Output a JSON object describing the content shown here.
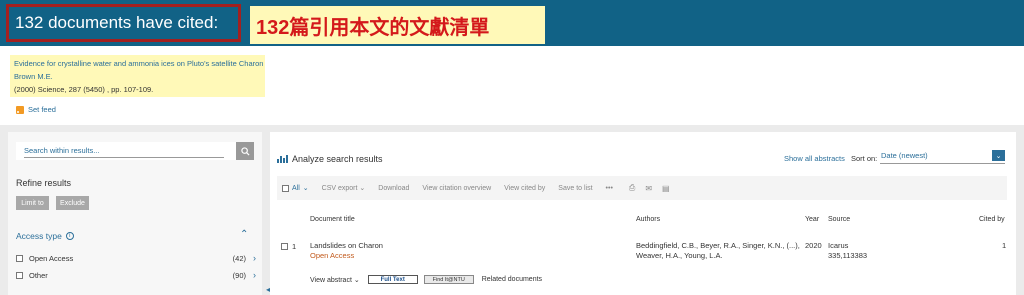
{
  "header": {
    "cited_count_text": "132 documents have cited:",
    "zh_annotation": "132篇引用本文的文獻清單"
  },
  "reference": {
    "title": "Evidence for crystalline water and ammonia ices on Pluto's satellite Charon",
    "author": "Brown M.E.",
    "citation": "(2000) Science, 287 (5450) , pp. 107-109."
  },
  "set_feed": "Set feed",
  "sidebar": {
    "search_placeholder": "Search within results...",
    "refine_title": "Refine results",
    "limit_to": "Limit to",
    "exclude": "Exclude",
    "access_type_label": "Access type",
    "facets": [
      {
        "label": "Open Access",
        "count": "(42)"
      },
      {
        "label": "Other",
        "count": "(90)"
      }
    ]
  },
  "main": {
    "analyze_label": "Analyze search results",
    "show_all_abstracts": "Show all abstracts",
    "sort_label": "Sort on:",
    "sort_value": "Date (newest)",
    "toolbar": {
      "all": "All",
      "csv_export": "CSV export",
      "download": "Download",
      "view_citation_overview": "View citation overview",
      "view_cited_by": "View cited by",
      "save_to_list": "Save to list",
      "more": "•••"
    },
    "columns": {
      "title": "Document title",
      "authors": "Authors",
      "year": "Year",
      "source": "Source",
      "cited_by": "Cited by"
    },
    "rows": [
      {
        "num": "1",
        "title": "Landslides on Charon",
        "access": "Open Access",
        "authors_line1": "Beddingfield, C.B., Beyer, R.A., Singer, K.N., (...),",
        "authors_line2": "Weaver, H.A., Young, L.A.",
        "year": "2020",
        "source_line1": "Icarus",
        "source_line2": "335,113383",
        "cited_by": "1",
        "view_abstract": "View abstract",
        "full_text": "Full Text",
        "findit": "Find It@NTU",
        "related": "Related documents"
      }
    ]
  },
  "colors": {
    "header_bg": "#116286",
    "highlight": "#fff9b8",
    "annotation_red": "#d4191b",
    "link_blue": "#2b6f9a",
    "open_access_orange": "#c25a1c"
  },
  "icons": [
    "rss-icon",
    "search-icon",
    "info-icon",
    "chevron-up-icon",
    "chevron-right-icon",
    "bar-chart-icon",
    "chevron-down-icon",
    "print-icon",
    "email-icon",
    "bibliography-icon",
    "collapse-left-icon"
  ]
}
